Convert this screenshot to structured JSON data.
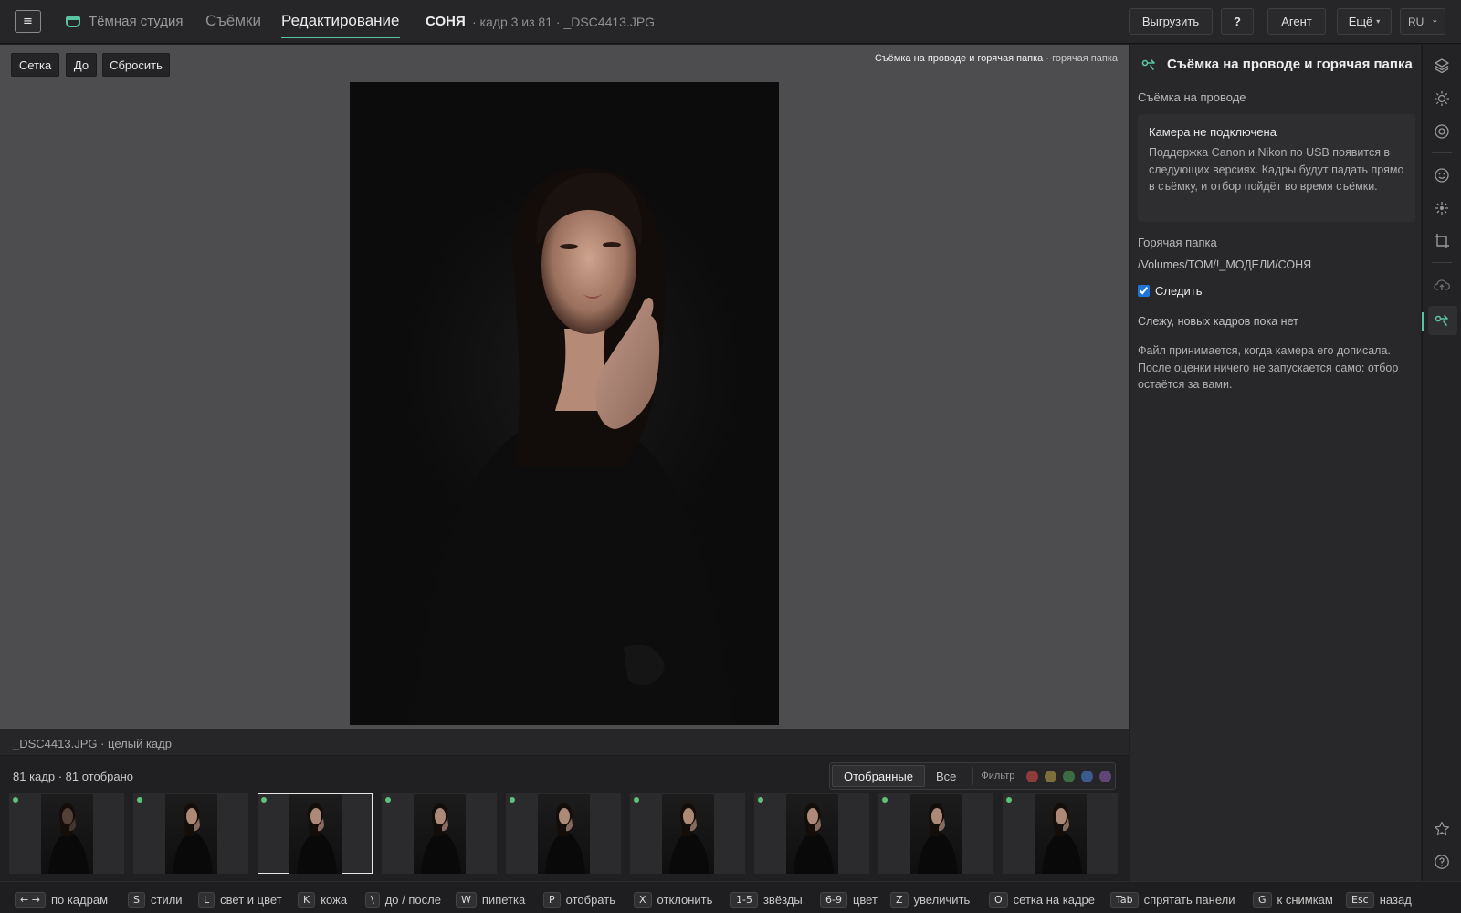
{
  "header": {
    "menu_glyph": "≡",
    "brand": "Тёмная студия",
    "tabs": [
      {
        "label": "Съёмки",
        "active": false
      },
      {
        "label": "Редактирование",
        "active": true
      }
    ],
    "project": "СОНЯ",
    "frame_info": "· кадр 3 из 81 · _DSC4413.JPG",
    "buttons": {
      "export": "Выгрузить",
      "help": "?",
      "agent": "Агент",
      "more": "Ещё",
      "lang": "RU"
    }
  },
  "canvas": {
    "tools": {
      "grid": "Сетка",
      "before": "До",
      "reset": "Сбросить"
    },
    "caption_main": "Съёмка на проводе и горячая папка",
    "caption_sub": "· горячая папка",
    "filename_bar": "_DSC4413.JPG · целый кадр"
  },
  "filmstrip": {
    "count": "81 кадр · 81 отобрано",
    "segments": [
      "Отобранные",
      "Все"
    ],
    "active_segment": "Отобранные",
    "filter_label": "Фильтр",
    "filter_colors": [
      "#8e3b3b",
      "#7d6f3a",
      "#3d6b43",
      "#3b5a8e",
      "#5f4677"
    ],
    "pick_color": "#5fc27c",
    "selected_index": 2,
    "thumb_count": 9
  },
  "right_panel": {
    "title": "Съёмка на проводе и горячая папка",
    "tether_label": "Съёмка на проводе",
    "camera_title": "Камера не подключена",
    "camera_body": "Поддержка Canon и Nikon по USB появится в следующих версиях. Кадры будут падать прямо в съёмку, и отбор пойдёт во время съёмки.",
    "hot_folder_label": "Горячая папка",
    "hot_folder_path": "/Volumes/TOM/!_МОДЕЛИ/СОНЯ",
    "follow_label": "Следить",
    "follow_checked": true,
    "status": "Слежу, новых кадров пока нет",
    "info": "Файл принимается, когда камера его дописала. После оценки ничего не запускается само: отбор остаётся за вами."
  },
  "rail_icons": [
    "layers-icon",
    "sun-icon",
    "aperture-icon",
    "face-icon",
    "sparkle-icon",
    "crop-icon",
    "cloud-upload-icon",
    "tether-icon",
    "star-icon",
    "help-circle-icon"
  ],
  "shortcuts": [
    {
      "key": "← →",
      "label": "по кадрам"
    },
    {
      "key": "S",
      "label": "стили"
    },
    {
      "key": "L",
      "label": "свет и цвет"
    },
    {
      "key": "K",
      "label": "кожа"
    },
    {
      "key": "\\",
      "label": "до / после"
    },
    {
      "key": "W",
      "label": "пипетка"
    },
    {
      "key": "P",
      "label": "отобрать"
    },
    {
      "key": "X",
      "label": "отклонить"
    },
    {
      "key": "1-5",
      "label": "звёзды"
    },
    {
      "key": "6-9",
      "label": "цвет"
    },
    {
      "key": "Z",
      "label": "увеличить"
    },
    {
      "key": "O",
      "label": "сетка на кадре"
    },
    {
      "key": "Tab",
      "label": "спрятать панели"
    },
    {
      "key": "G",
      "label": "к снимкам"
    },
    {
      "key": "Esc",
      "label": "назад"
    }
  ],
  "accent_color": "#58c4a0"
}
